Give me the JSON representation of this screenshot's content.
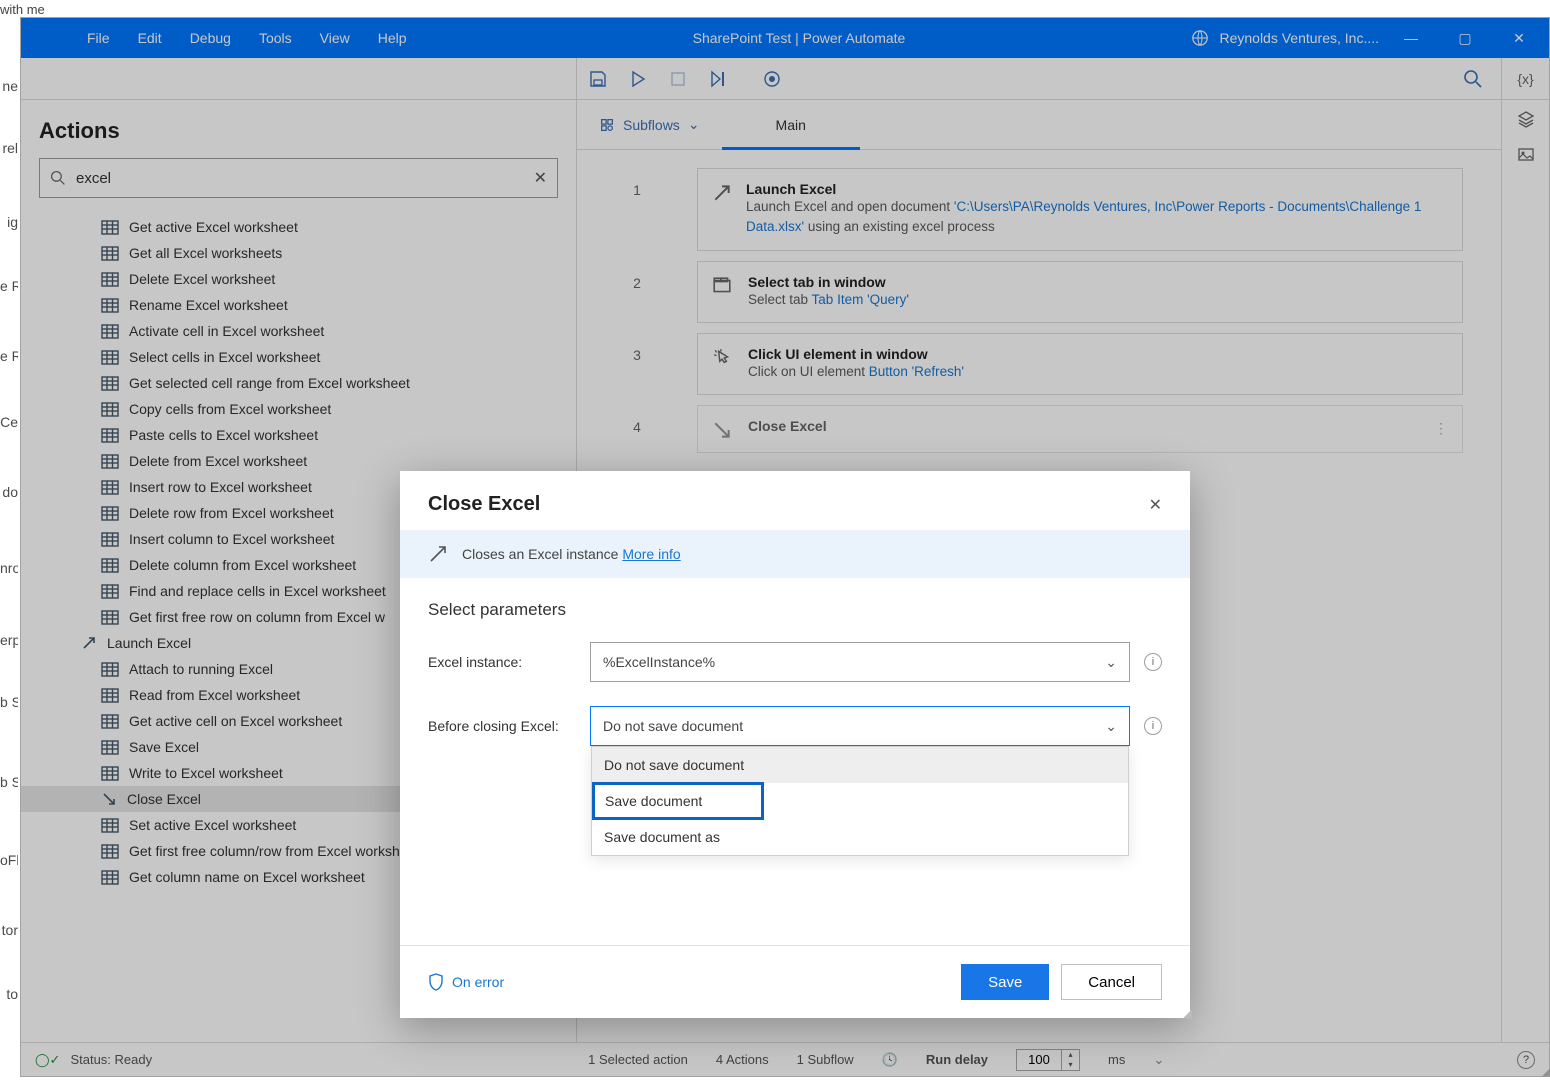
{
  "top_crumb": "with me",
  "left_fragments": [
    "ne",
    "rel",
    "ig",
    "e R",
    "e R",
    "Ce",
    "do",
    "nro",
    "erp",
    "b S",
    "b S",
    "oFlo",
    "tor",
    "to"
  ],
  "titlebar": {
    "menus": [
      "File",
      "Edit",
      "Debug",
      "Tools",
      "View",
      "Help"
    ],
    "title": "SharePoint Test | Power Automate",
    "org": "Reynolds Ventures, Inc...."
  },
  "vars_token": "{x}",
  "actions": {
    "title": "Actions",
    "search_value": "excel",
    "list": [
      {
        "label": "Get active Excel worksheet",
        "kind": "ws"
      },
      {
        "label": "Get all Excel worksheets",
        "kind": "ws"
      },
      {
        "label": "Delete Excel worksheet",
        "kind": "ws"
      },
      {
        "label": "Rename Excel worksheet",
        "kind": "ws"
      },
      {
        "label": "Activate cell in Excel worksheet",
        "kind": "ws"
      },
      {
        "label": "Select cells in Excel worksheet",
        "kind": "ws"
      },
      {
        "label": "Get selected cell range from Excel worksheet",
        "kind": "ws"
      },
      {
        "label": "Copy cells from Excel worksheet",
        "kind": "ws"
      },
      {
        "label": "Paste cells to Excel worksheet",
        "kind": "ws"
      },
      {
        "label": "Delete from Excel worksheet",
        "kind": "ws"
      },
      {
        "label": "Insert row to Excel worksheet",
        "kind": "ws"
      },
      {
        "label": "Delete row from Excel worksheet",
        "kind": "ws"
      },
      {
        "label": "Insert column to Excel worksheet",
        "kind": "ws"
      },
      {
        "label": "Delete column from Excel worksheet",
        "kind": "ws"
      },
      {
        "label": "Find and replace cells in Excel worksheet",
        "kind": "ws"
      },
      {
        "label": "Get first free row on column from Excel w",
        "kind": "ws"
      },
      {
        "label": "Launch Excel",
        "kind": "launch"
      },
      {
        "label": "Attach to running Excel",
        "kind": "ws"
      },
      {
        "label": "Read from Excel worksheet",
        "kind": "ws"
      },
      {
        "label": "Get active cell on Excel worksheet",
        "kind": "ws"
      },
      {
        "label": "Save Excel",
        "kind": "ws"
      },
      {
        "label": "Write to Excel worksheet",
        "kind": "ws"
      },
      {
        "label": "Close Excel",
        "kind": "close",
        "sel": true
      },
      {
        "label": "Set active Excel worksheet",
        "kind": "ws"
      },
      {
        "label": "Get first free column/row from Excel worksh",
        "kind": "ws"
      },
      {
        "label": "Get column name on Excel worksheet",
        "kind": "ws"
      }
    ]
  },
  "subflows": {
    "label": "Subflows",
    "tab": "Main"
  },
  "steps": [
    {
      "num": "1",
      "title": "Launch Excel",
      "desc_pre": "Launch Excel and open document ",
      "link": "'C:\\Users\\PA\\Reynolds Ventures, Inc\\Power Reports - Documents\\Challenge 1 Data.xlsx'",
      "desc_post": " using an existing excel process",
      "icon": "launch"
    },
    {
      "num": "2",
      "title": "Select tab in window",
      "desc_pre": "Select tab ",
      "link": "Tab Item 'Query'",
      "desc_post": "",
      "icon": "tab"
    },
    {
      "num": "3",
      "title": "Click UI element in window",
      "desc_pre": "Click on UI element ",
      "link": "Button 'Refresh'",
      "desc_post": "",
      "icon": "click"
    },
    {
      "num": "4",
      "title": "Close Excel",
      "desc_pre": "",
      "link": "",
      "desc_post": "",
      "icon": "close",
      "faded": true,
      "more": true
    }
  ],
  "modal": {
    "title": "Close Excel",
    "info_text": "Closes an Excel instance ",
    "info_link": "More info",
    "section": "Select parameters",
    "param1_label": "Excel instance:",
    "param1_value": "%ExcelInstance%",
    "param2_label": "Before closing Excel:",
    "param2_value": "Do not save document",
    "options": [
      {
        "text": "Do not save document",
        "state": "hover"
      },
      {
        "text": "Save document",
        "state": "highlight"
      },
      {
        "text": "Save document as",
        "state": ""
      }
    ],
    "on_error": "On error",
    "save_btn": "Save",
    "cancel_btn": "Cancel"
  },
  "status": {
    "ready": "Status: Ready",
    "selected": "1 Selected action",
    "actions": "4 Actions",
    "subflows": "1 Subflow",
    "run_delay": "Run delay",
    "run_value": "100",
    "unit": "ms"
  }
}
